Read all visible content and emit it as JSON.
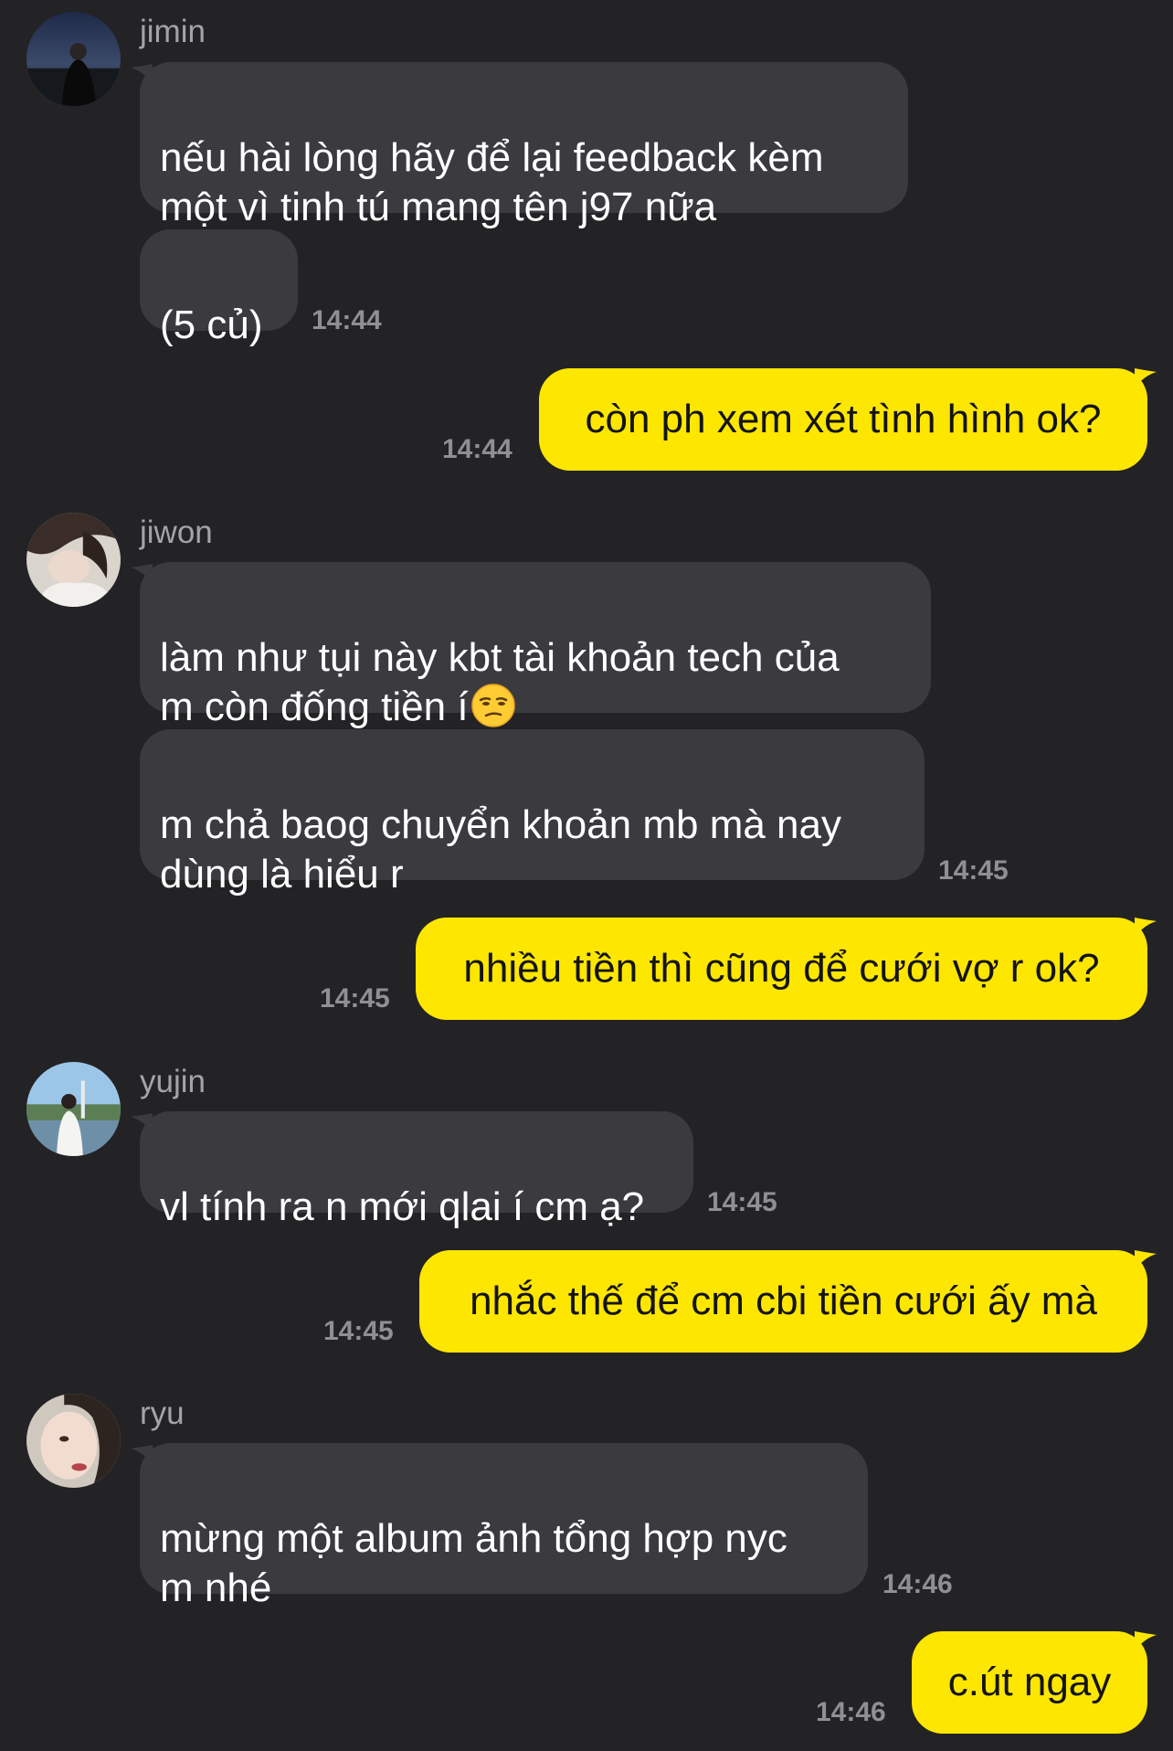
{
  "conversation": {
    "jimin": {
      "name": "jimin",
      "avatar_icon": "profile-photo-jimin",
      "messages": [
        "nếu hài lòng hãy để lại feedback kèm\nmột vì tinh tú mang tên j97 nữa",
        "(5 củ)"
      ],
      "time": "14:44"
    },
    "me_1": {
      "text": "còn ph xem xét tình hình ok?",
      "time": "14:44"
    },
    "jiwon": {
      "name": "jiwon",
      "avatar_icon": "profile-photo-jiwon",
      "messages": [
        "làm như tụi này kbt tài khoản tech của\nm còn đống tiền í",
        "m chả baog chuyển khoản mb mà nay\ndùng là hiểu r"
      ],
      "emoji": "unamused-face-emoji",
      "time": "14:45"
    },
    "me_2": {
      "text": "nhiều tiền thì cũng để cưới vợ r ok?",
      "time": "14:45"
    },
    "yujin": {
      "name": "yujin",
      "avatar_icon": "profile-photo-yujin",
      "messages": [
        "vl tính ra n mới qlai í cm ạ?"
      ],
      "time": "14:45"
    },
    "me_3": {
      "text": "nhắc thế để cm cbi tiền cưới ấy mà",
      "time": "14:45"
    },
    "ryu": {
      "name": "ryu",
      "avatar_icon": "profile-photo-ryu",
      "messages": [
        "mừng một album ảnh tổng hợp nyc\nm nhé"
      ],
      "time": "14:46"
    },
    "me_4": {
      "text": "c.út ngay",
      "time": "14:46"
    }
  },
  "colors": {
    "background": "#232326",
    "incoming_bubble": "#3b3b3f",
    "outgoing_bubble": "#fde600",
    "sender_name": "#a4a4a8",
    "timestamp": "#8f8f94"
  }
}
